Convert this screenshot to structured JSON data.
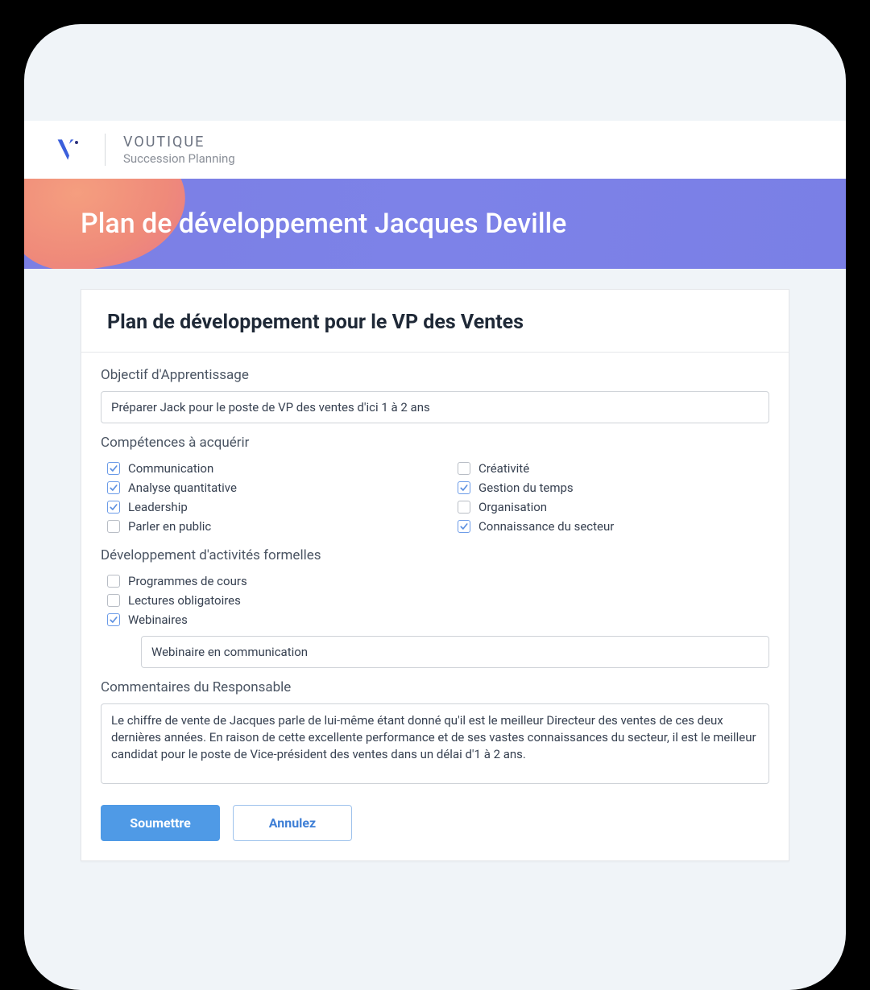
{
  "brand": {
    "name": "VOUTIQUE",
    "subtitle": "Succession Planning"
  },
  "hero": {
    "title": "Plan de développement Jacques Deville"
  },
  "card": {
    "title": "Plan de développement pour le VP des Ventes"
  },
  "sections": {
    "objective_label": "Objectif d'Apprentissage",
    "objective_value": "Préparer Jack pour le poste de VP des ventes d'ici 1 à 2 ans",
    "skills_label": "Compétences à acquérir",
    "skills_col1": [
      {
        "label": "Communication",
        "checked": true
      },
      {
        "label": "Analyse quantitative",
        "checked": true
      },
      {
        "label": "Leadership",
        "checked": true
      },
      {
        "label": "Parler en public",
        "checked": false
      }
    ],
    "skills_col2": [
      {
        "label": "Créativité",
        "checked": false
      },
      {
        "label": "Gestion du temps",
        "checked": true
      },
      {
        "label": "Organisation",
        "checked": false
      },
      {
        "label": "Connaissance du secteur",
        "checked": true
      }
    ],
    "activities_label": "Développement d'activités formelles",
    "activities": [
      {
        "label": "Programmes de cours",
        "checked": false
      },
      {
        "label": "Lectures obligatoires",
        "checked": false
      },
      {
        "label": "Webinaires",
        "checked": true
      }
    ],
    "activity_detail_value": "Webinaire en communication",
    "comments_label": "Commentaires du Responsable",
    "comments_value": "Le chiffre de vente de Jacques parle de lui-même étant donné qu'il est le meilleur Directeur des ventes de ces deux dernières années. En raison de cette excellente performance et de ses vastes connaissances du secteur, il est le meilleur candidat pour le poste de Vice-président des ventes dans un délai d'1 à 2 ans."
  },
  "buttons": {
    "submit": "Soumettre",
    "cancel": "Annulez"
  }
}
